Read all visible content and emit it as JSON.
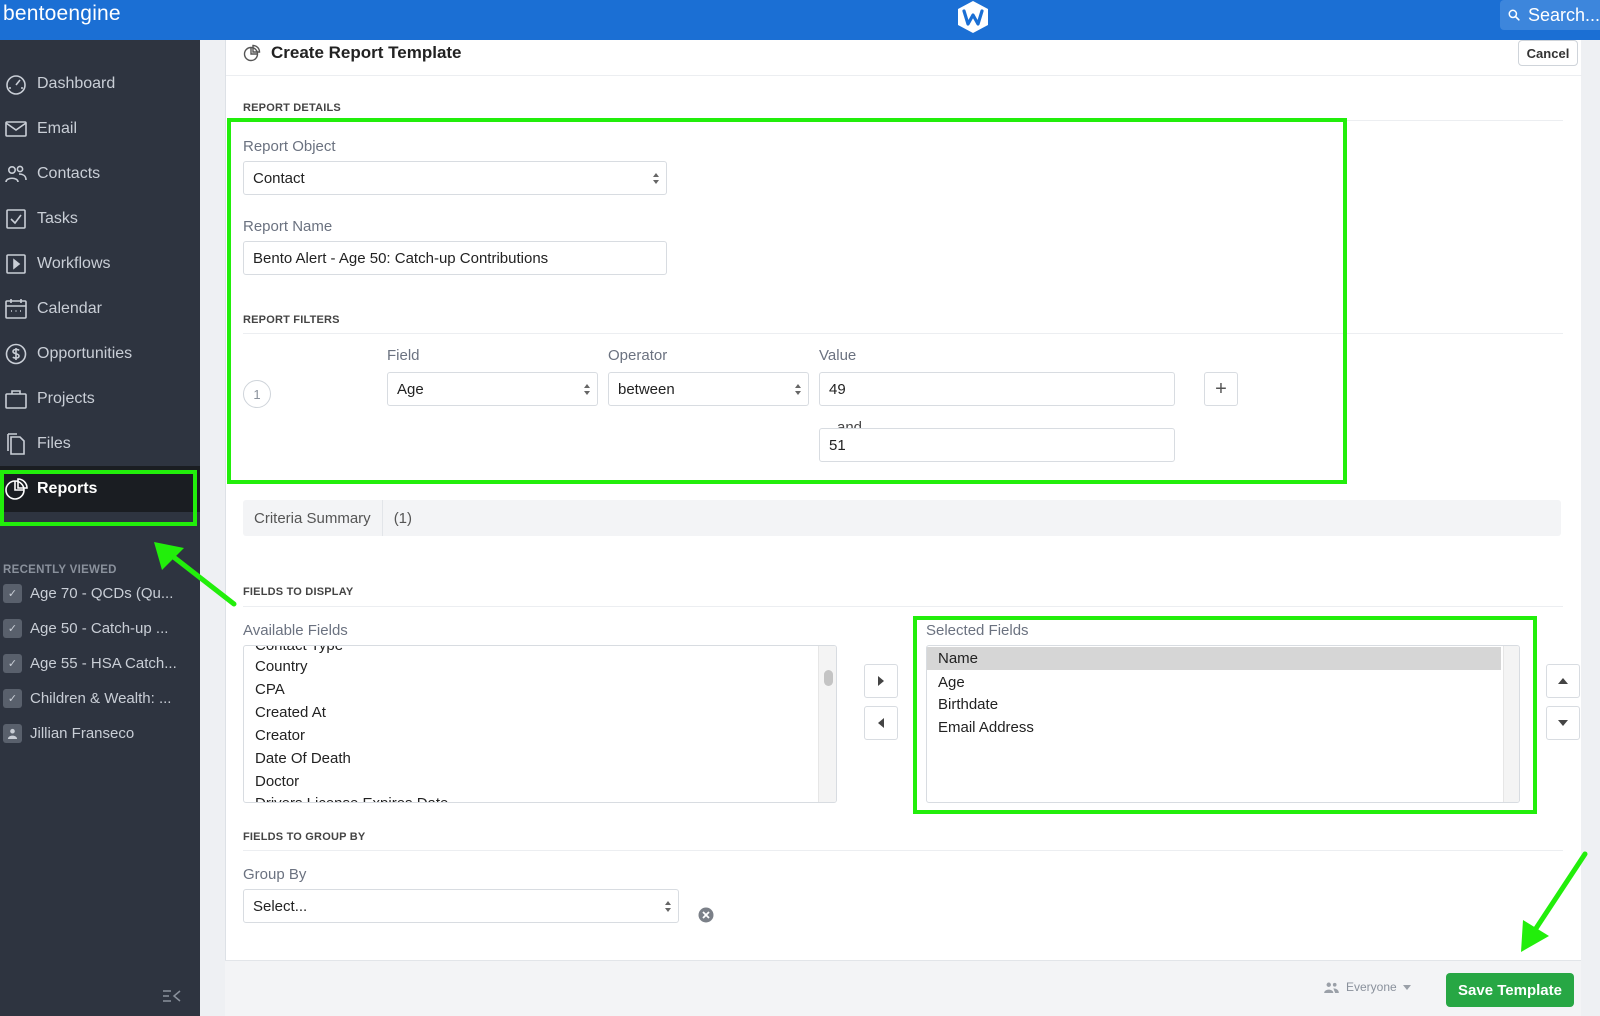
{
  "header": {
    "brand": "bentoengine",
    "search_placeholder": "Search..."
  },
  "sidebar": {
    "items": [
      {
        "label": "Dashboard",
        "icon": "dashboard-icon"
      },
      {
        "label": "Email",
        "icon": "envelope-icon"
      },
      {
        "label": "Contacts",
        "icon": "people-icon"
      },
      {
        "label": "Tasks",
        "icon": "checkbox-icon"
      },
      {
        "label": "Workflows",
        "icon": "play-icon"
      },
      {
        "label": "Calendar",
        "icon": "calendar-icon"
      },
      {
        "label": "Opportunities",
        "icon": "dollar-icon"
      },
      {
        "label": "Projects",
        "icon": "briefcase-icon"
      },
      {
        "label": "Files",
        "icon": "files-icon"
      },
      {
        "label": "Reports",
        "icon": "pie-chart-icon",
        "active": true
      }
    ],
    "recent_title": "RECENTLY VIEWED",
    "recent": [
      "Age 70 - QCDs (Qu...",
      "Age 50 - Catch-up ...",
      "Age 55 - HSA Catch...",
      "Children & Wealth: ...",
      "Jillian Franseco"
    ]
  },
  "page": {
    "title": "Create Report Template",
    "cancel_label": "Cancel"
  },
  "report_details": {
    "section_title": "REPORT DETAILS",
    "object_label": "Report Object",
    "object_value": "Contact",
    "name_label": "Report Name",
    "name_value": "Bento Alert - Age 50: Catch-up Contributions"
  },
  "report_filters": {
    "section_title": "REPORT FILTERS",
    "field_label": "Field",
    "operator_label": "Operator",
    "value_label": "Value",
    "row_number": "1",
    "field_value": "Age",
    "operator_value": "between",
    "value_1": "49",
    "and_label": "and",
    "value_2": "51",
    "add_label": "+"
  },
  "criteria": {
    "label": "Criteria Summary",
    "count": "(1)"
  },
  "fields_display": {
    "section_title": "FIELDS TO DISPLAY",
    "available_label": "Available Fields",
    "available": [
      "Contact Type",
      "Country",
      "CPA",
      "Created At",
      "Creator",
      "Date Of Death",
      "Doctor",
      "Drivers License Expires Date"
    ],
    "selected_label": "Selected Fields",
    "selected": [
      "Name",
      "Age",
      "Birthdate",
      "Email Address"
    ]
  },
  "group_by": {
    "section_title": "FIELDS TO GROUP BY",
    "label": "Group By",
    "value": "Select..."
  },
  "footer": {
    "visibility": "Everyone",
    "save_label": "Save Template"
  },
  "colors": {
    "topbar": "#1b6fd4",
    "sidebar": "#2e3440",
    "highlight": "#22ee0b",
    "save": "#27a744"
  }
}
